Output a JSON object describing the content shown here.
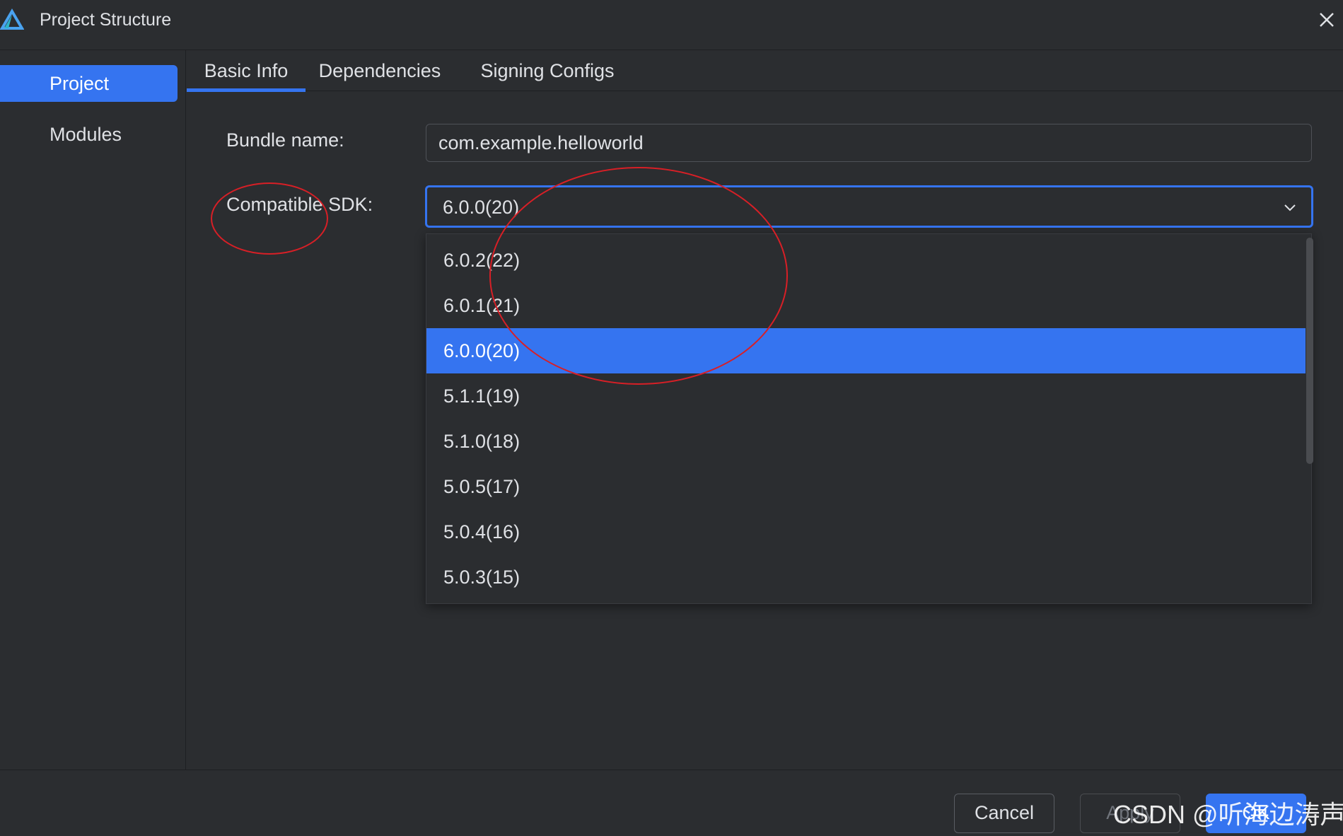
{
  "window": {
    "title": "Project Structure",
    "logo_icon": "deveco-logo-icon",
    "close_icon": "close-icon"
  },
  "sidebar": {
    "items": [
      {
        "label": "Project",
        "active": true
      },
      {
        "label": "Modules",
        "active": false
      }
    ]
  },
  "tabs": [
    {
      "label": "Basic Info",
      "active": true
    },
    {
      "label": "Dependencies",
      "active": false
    },
    {
      "label": "Signing Configs",
      "active": false
    }
  ],
  "form": {
    "bundle_name_label": "Bundle name:",
    "bundle_name_value": "com.example.helloworld",
    "sdk_label": "Compatible SDK:",
    "sdk_value": "6.0.0(20)",
    "sdk_options": [
      {
        "label": "6.0.2(22)",
        "selected": false
      },
      {
        "label": "6.0.1(21)",
        "selected": false
      },
      {
        "label": "6.0.0(20)",
        "selected": true
      },
      {
        "label": "5.1.1(19)",
        "selected": false
      },
      {
        "label": "5.1.0(18)",
        "selected": false
      },
      {
        "label": "5.0.5(17)",
        "selected": false
      },
      {
        "label": "5.0.4(16)",
        "selected": false
      },
      {
        "label": "5.0.3(15)",
        "selected": false
      }
    ]
  },
  "footer": {
    "cancel_label": "Cancel",
    "apply_label": "Apply",
    "ok_label": "OK"
  },
  "watermark": "CSDN @听海边涛声",
  "colors": {
    "background": "#2b2d30",
    "accent": "#3574f0",
    "text": "#dfe1e5",
    "annotation": "#d81f26"
  }
}
